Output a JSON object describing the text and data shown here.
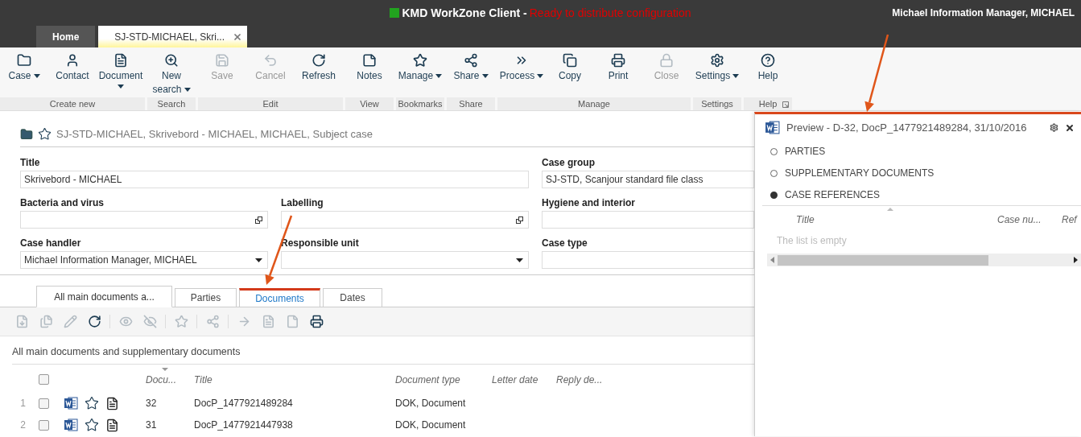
{
  "header": {
    "app_title": "KMD WorkZone Client -",
    "status": "Ready to distribute configuration",
    "user": "Michael Information Manager, MICHAEL"
  },
  "window_tabs": [
    {
      "label": "Home",
      "selected": false,
      "closable": false
    },
    {
      "label": "SJ-STD-MICHAEL, Skri...",
      "selected": true,
      "closable": true
    }
  ],
  "ribbon": [
    {
      "label": "Create new",
      "buttons": [
        {
          "label": "Case",
          "dropdown": true,
          "disabled": false
        },
        {
          "label": "Contact",
          "disabled": false
        },
        {
          "label": "Document",
          "dropdown": true,
          "caret_below": true,
          "disabled": false
        }
      ]
    },
    {
      "label": "Search",
      "buttons": [
        {
          "label": "New search",
          "dropdown": true,
          "disabled": false
        }
      ]
    },
    {
      "label": "Edit",
      "buttons": [
        {
          "label": "Save",
          "disabled": true
        },
        {
          "label": "Cancel",
          "disabled": true
        },
        {
          "label": "Refresh",
          "disabled": false
        }
      ]
    },
    {
      "label": "View",
      "buttons": [
        {
          "label": "Notes",
          "disabled": false
        }
      ]
    },
    {
      "label": "Bookmarks",
      "buttons": [
        {
          "label": "Manage",
          "dropdown": true,
          "disabled": false
        }
      ]
    },
    {
      "label": "Share",
      "buttons": [
        {
          "label": "Share",
          "dropdown": true,
          "disabled": false
        }
      ]
    },
    {
      "label": "Manage",
      "buttons": [
        {
          "label": "Process",
          "dropdown": true,
          "disabled": false
        },
        {
          "label": "Copy",
          "disabled": false
        },
        {
          "label": "Print",
          "disabled": false
        },
        {
          "label": "Close",
          "disabled": true
        }
      ]
    },
    {
      "label": "Settings",
      "buttons": [
        {
          "label": "Settings",
          "dropdown": true,
          "disabled": false
        }
      ]
    },
    {
      "label": "Help",
      "launcher": true,
      "buttons": [
        {
          "label": "Help",
          "disabled": false
        }
      ]
    }
  ],
  "case": {
    "heading": "SJ-STD-MICHAEL, Skrivebord - MICHAEL, MICHAEL, Subject case",
    "favorite": false
  },
  "form": [
    {
      "label": "Title",
      "value": "Skrivebord - MICHAEL",
      "kind": "wide"
    },
    {
      "label": "Case group",
      "value": "SJ-STD, Scanjour standard file class",
      "kind": "text"
    },
    {
      "label": "Bacteria and virus",
      "kind": "popout"
    },
    {
      "label": "Labelling",
      "kind": "popout"
    },
    {
      "label": "Hygiene and interior",
      "kind": "text"
    },
    {
      "label": "Case handler",
      "value": "Michael Information Manager, MICHAEL",
      "kind": "select"
    },
    {
      "label": "Responsible unit",
      "kind": "select"
    },
    {
      "label": "Case type",
      "kind": "text"
    }
  ],
  "doc_tabs": [
    {
      "label": "All main documents a...",
      "selected": true,
      "highlighted": false
    },
    {
      "label": "Parties",
      "selected": false,
      "highlighted": false
    },
    {
      "label": "Documents",
      "selected": false,
      "highlighted": true
    },
    {
      "label": "Dates",
      "selected": false,
      "highlighted": false
    }
  ],
  "doc_toolbar": [
    [
      {
        "disabled": true
      },
      {
        "disabled": true
      },
      {
        "disabled": true
      },
      {
        "disabled": false
      }
    ],
    [
      {
        "disabled": true
      },
      {
        "disabled": true
      }
    ],
    [
      {
        "disabled": true
      }
    ],
    [
      {
        "disabled": true
      }
    ],
    [
      {
        "disabled": true
      },
      {
        "disabled": true
      },
      {
        "disabled": true
      },
      {
        "disabled": false
      }
    ]
  ],
  "list_title": "All main documents and supplementary documents",
  "table": {
    "columns": [
      "Docu...",
      "Title",
      "Document type",
      "Letter date",
      "Reply de..."
    ],
    "all_checked": false,
    "rows": [
      {
        "index": "1",
        "checked": false,
        "favorite": false,
        "number": "32",
        "title": "DocP_1477921489284",
        "type": "DOK, Document"
      },
      {
        "index": "2",
        "checked": false,
        "favorite": false,
        "number": "31",
        "title": "DocP_1477921447938",
        "type": "DOK, Document"
      }
    ]
  },
  "preview": {
    "title": "Preview - D-32, DocP_1477921489284, 31/10/2016",
    "sections": [
      {
        "label": "PARTIES",
        "selected": false
      },
      {
        "label": "SUPPLEMENTARY DOCUMENTS",
        "selected": false
      },
      {
        "label": "CASE REFERENCES",
        "selected": true
      }
    ],
    "columns": [
      "Title",
      "Case nu...",
      "Ref"
    ],
    "empty_text": "The list is empty"
  }
}
